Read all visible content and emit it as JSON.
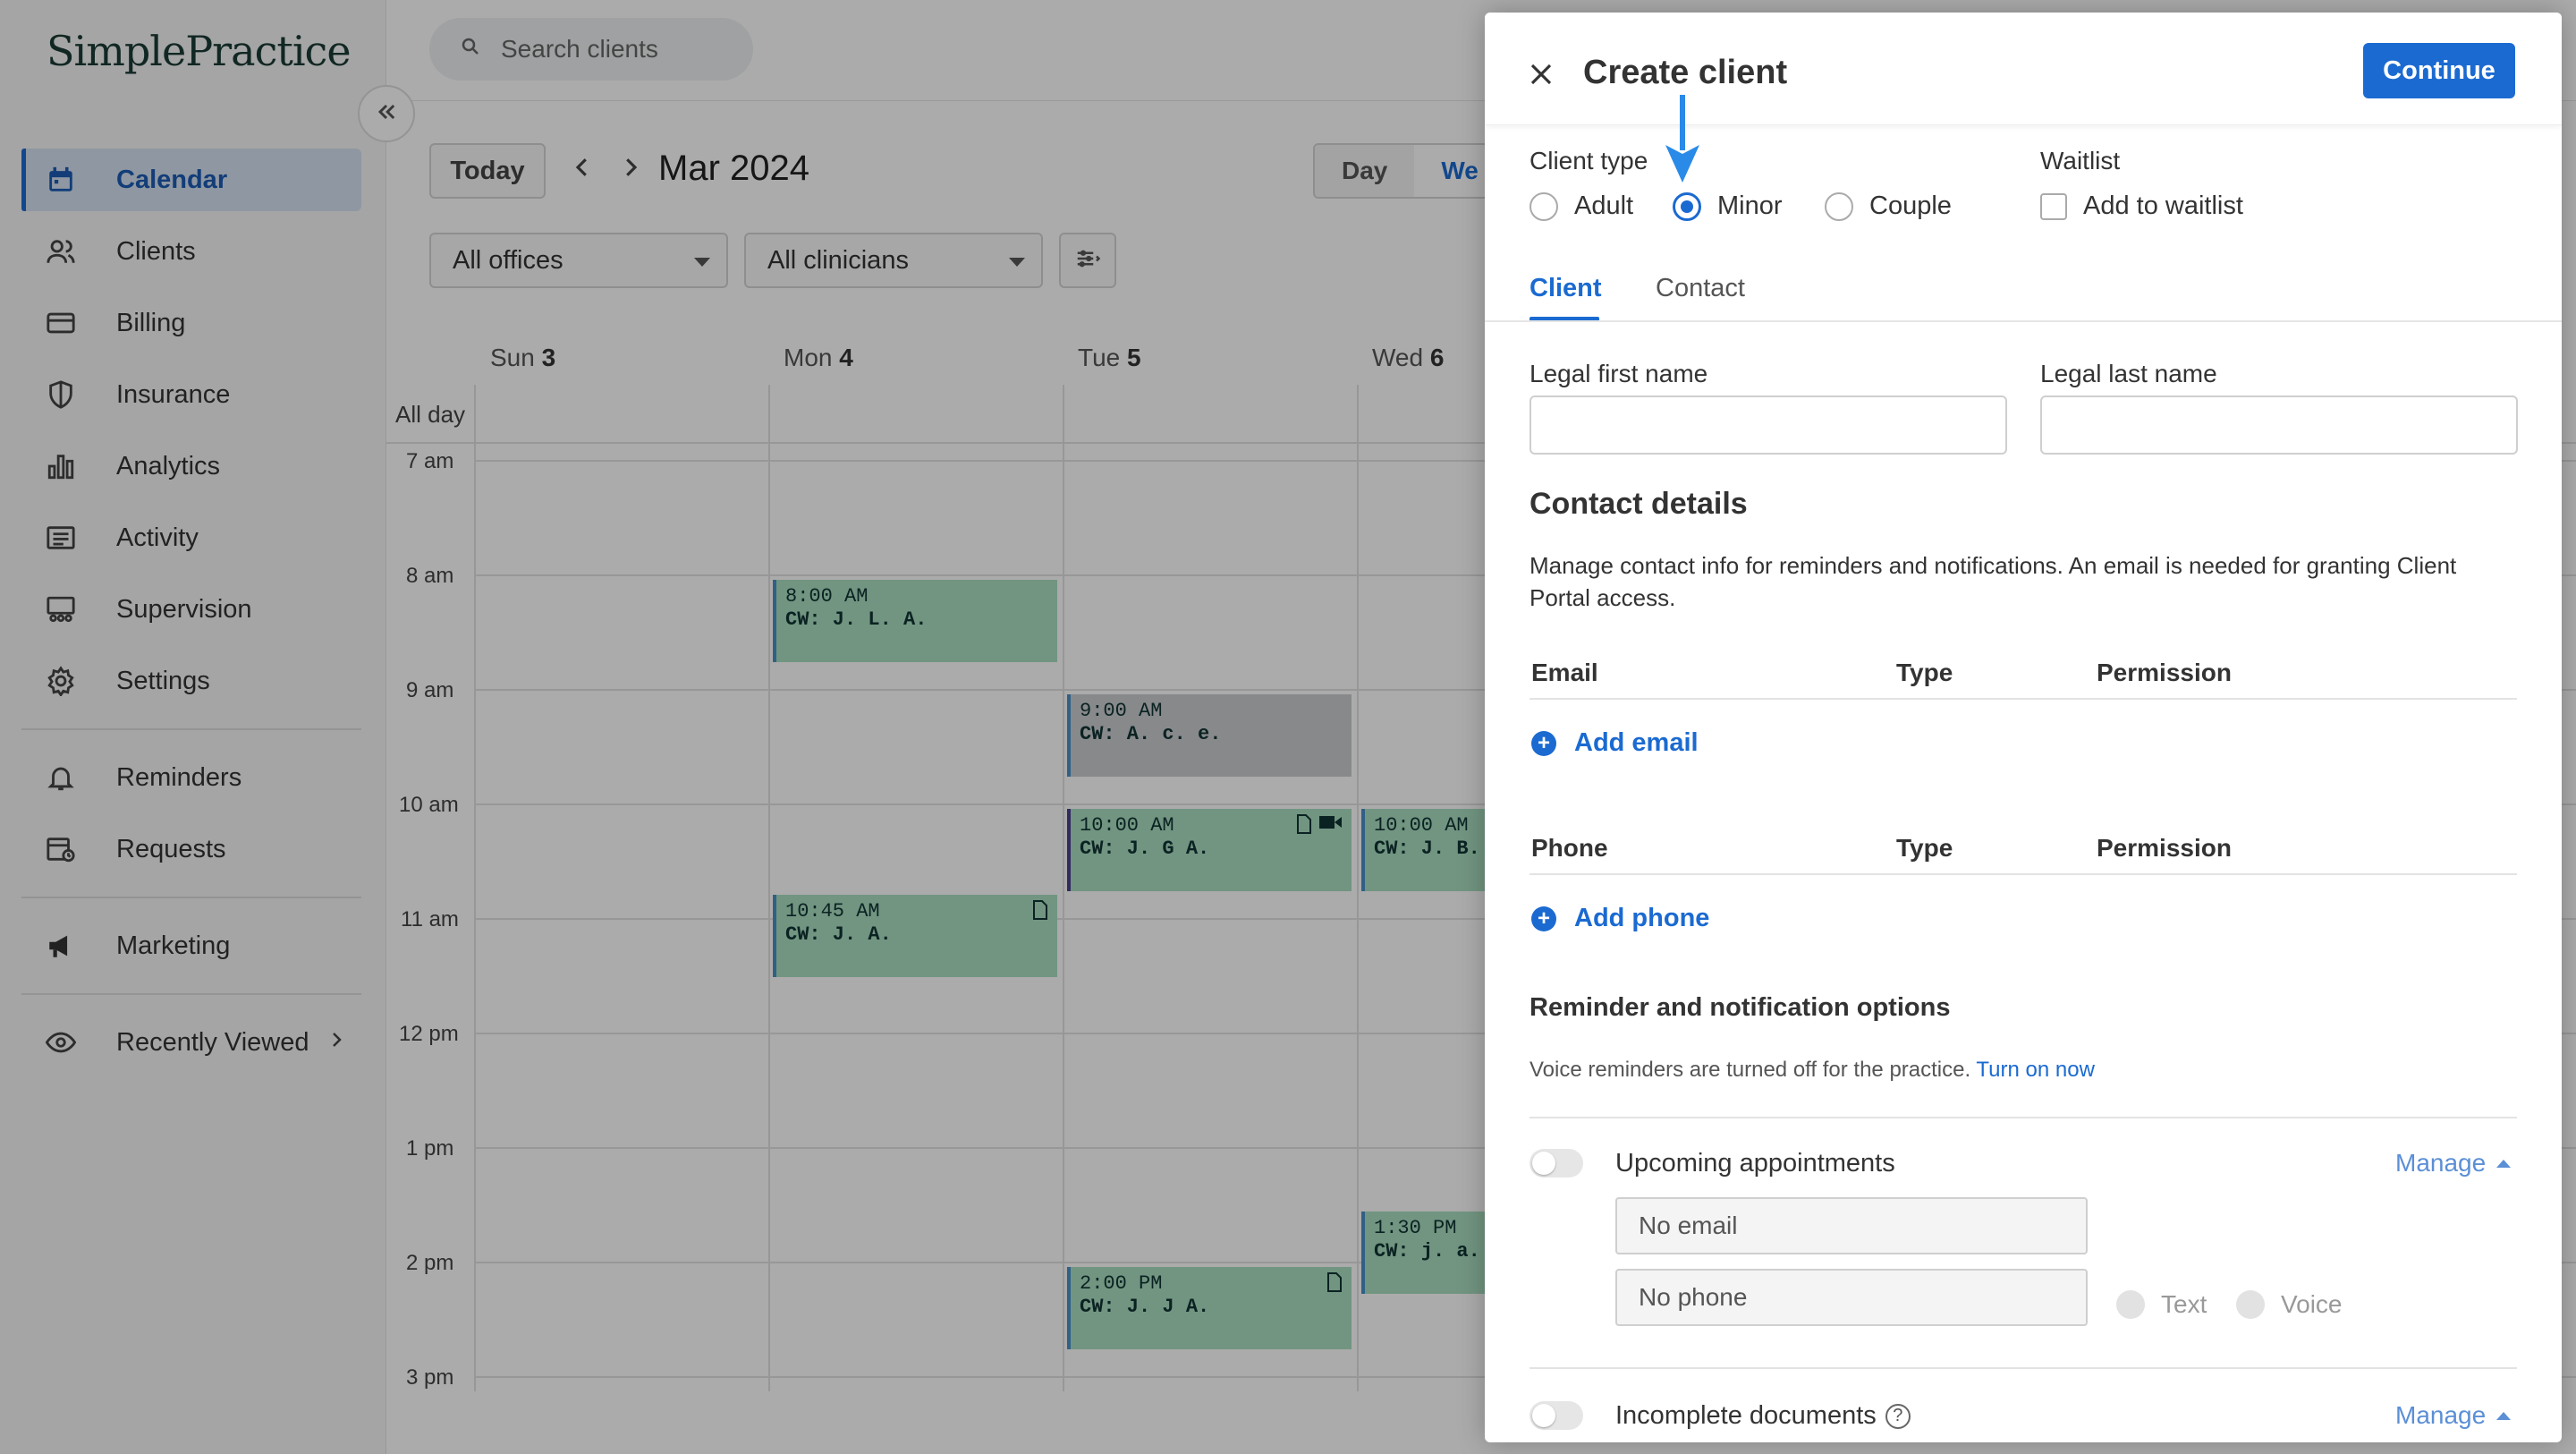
{
  "app": {
    "brand": "SimplePractice"
  },
  "sidebar": {
    "items": [
      {
        "label": "Calendar",
        "icon": "calendar-icon",
        "active": true
      },
      {
        "label": "Clients",
        "icon": "users-icon"
      },
      {
        "label": "Billing",
        "icon": "credit-card-icon"
      },
      {
        "label": "Insurance",
        "icon": "shield-icon"
      },
      {
        "label": "Analytics",
        "icon": "bar-chart-icon"
      },
      {
        "label": "Activity",
        "icon": "list-icon"
      },
      {
        "label": "Supervision",
        "icon": "supervision-icon"
      },
      {
        "label": "Settings",
        "icon": "gear-icon"
      },
      {
        "label": "Reminders",
        "icon": "bell-icon"
      },
      {
        "label": "Requests",
        "icon": "calendar-clock-icon"
      },
      {
        "label": "Marketing",
        "icon": "megaphone-icon"
      },
      {
        "label": "Recently Viewed",
        "icon": "eye-icon"
      }
    ]
  },
  "header": {
    "search_placeholder": "Search clients"
  },
  "calendar": {
    "today_label": "Today",
    "month": "Mar 2024",
    "views": [
      "Day",
      "We"
    ],
    "offices": "All offices",
    "clinicians": "All clinicians",
    "days": [
      {
        "name": "Sun",
        "num": "3"
      },
      {
        "name": "Mon",
        "num": "4"
      },
      {
        "name": "Tue",
        "num": "5"
      },
      {
        "name": "Wed",
        "num": "6"
      }
    ],
    "allday_label": "All day",
    "hours": [
      "7 am",
      "8 am",
      "9 am",
      "10 am",
      "11 am",
      "12 pm",
      "1 pm",
      "2 pm",
      "3 pm"
    ],
    "events": [
      {
        "time": "8:00 AM",
        "client": "CW: J. L. A."
      },
      {
        "time": "9:00 AM",
        "client": "CW: A. c. e."
      },
      {
        "time": "10:00 AM",
        "client": "CW: J. G A."
      },
      {
        "time": "10:00 AM",
        "client": "CW: J. B. A."
      },
      {
        "time": "10:45 AM",
        "client": "CW: J. A."
      },
      {
        "time": "1:30 PM",
        "client": "CW: j. a."
      },
      {
        "time": "2:00 PM",
        "client": "CW: J. J A."
      }
    ]
  },
  "drawer": {
    "title": "Create client",
    "continue_label": "Continue",
    "client_type_label": "Client type",
    "client_types": [
      "Adult",
      "Minor",
      "Couple"
    ],
    "selected_type": "Minor",
    "waitlist_label": "Waitlist",
    "waitlist_checkbox": "Add to waitlist",
    "tabs": [
      "Client",
      "Contact"
    ],
    "legal_first_name": "Legal first name",
    "legal_last_name": "Legal last name",
    "contact_details_title": "Contact details",
    "contact_details_desc_1": "Manage contact info for reminders and notifications. An email is needed for granting Client",
    "contact_details_desc_2": "Portal access.",
    "email_cols": [
      "Email",
      "Type",
      "Permission"
    ],
    "add_email": "Add email",
    "phone_cols": [
      "Phone",
      "Type",
      "Permission"
    ],
    "add_phone": "Add phone",
    "reminder_title": "Reminder and notification options",
    "voice_note": "Voice reminders are turned off for the practice.",
    "turn_on_link": "Turn on now",
    "upcoming_label": "Upcoming appointments",
    "manage_label": "Manage",
    "no_email": "No email",
    "no_phone": "No phone",
    "text_label": "Text",
    "voice_label": "Voice",
    "incomplete_label": "Incomplete documents",
    "help_glyph": "?"
  },
  "colors": {
    "accent": "#1b6ad1",
    "event_green": "#a9dfc0",
    "event_gray": "#c9ccd0"
  }
}
